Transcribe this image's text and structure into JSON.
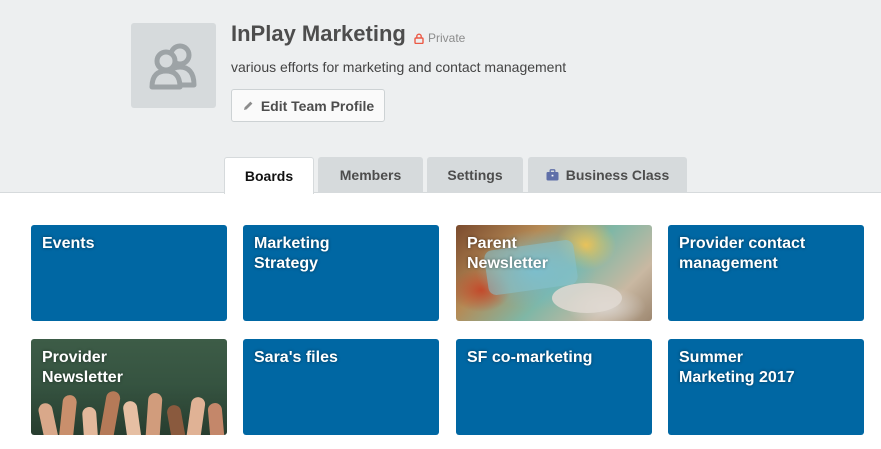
{
  "team": {
    "name": "InPlay Marketing",
    "privacy": "Private",
    "description": "various efforts for marketing and contact management",
    "edit_label": "Edit Team Profile"
  },
  "tabs": [
    {
      "label": "Boards",
      "active": true
    },
    {
      "label": "Members",
      "active": false
    },
    {
      "label": "Settings",
      "active": false
    },
    {
      "label": "Business Class",
      "active": false,
      "icon": "briefcase-icon"
    }
  ],
  "boards": [
    {
      "title": "Events",
      "background": "#0067a3"
    },
    {
      "title": "Marketing Strategy",
      "background": "#0067a3"
    },
    {
      "title": "Parent Newsletter",
      "background": "photo-children-painting"
    },
    {
      "title": "Provider contact management",
      "background": "#0067a3"
    },
    {
      "title": "Provider Newsletter",
      "background": "photo-raised-hands"
    },
    {
      "title": "Sara's files",
      "background": "#0067a3"
    },
    {
      "title": "SF co-marketing",
      "background": "#0067a3"
    },
    {
      "title": "Summer Marketing 2017",
      "background": "#0067a3"
    }
  ],
  "colors": {
    "header_bg": "#edeff0",
    "board_blue": "#0067a3",
    "tab_bg": "#d6dadc",
    "private_lock": "#eb5a46"
  }
}
